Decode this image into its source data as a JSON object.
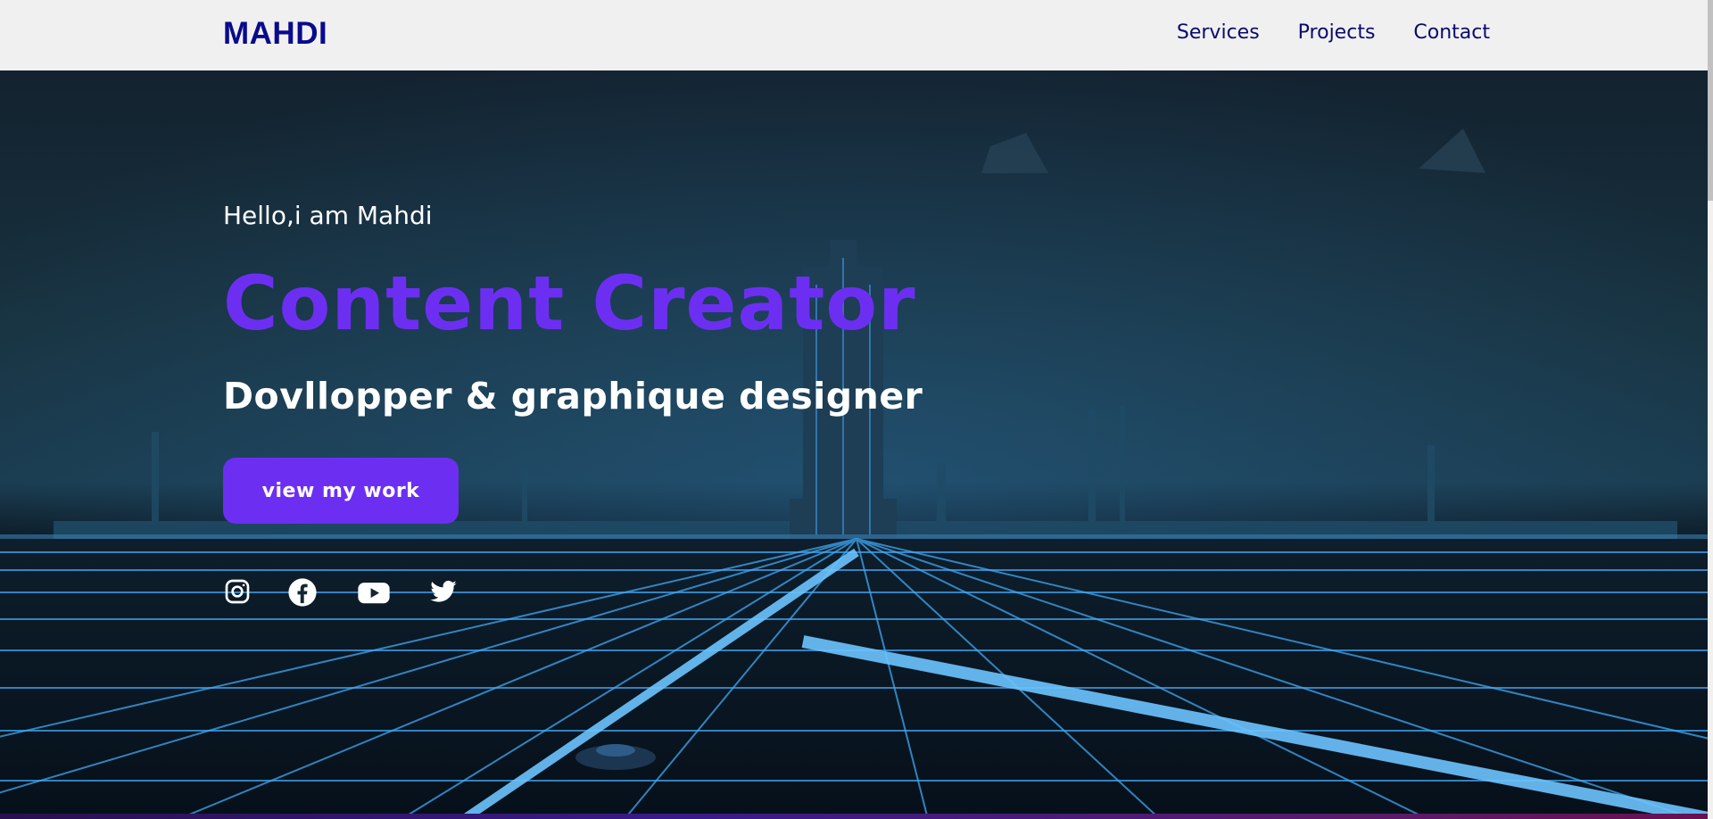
{
  "navbar": {
    "brand": "MAHDI",
    "links": [
      "Services",
      "Projects",
      "Contact"
    ]
  },
  "hero": {
    "greeting": "Hello,i am Mahdi",
    "headline": "Content Creator",
    "subheadline": "Dovllopper & graphique designer",
    "cta_label": "view my work"
  },
  "socials": [
    "instagram-icon",
    "facebook-icon",
    "youtube-icon",
    "twitter-icon"
  ],
  "colors": {
    "brand": "#0a0a8c",
    "accent": "#6c2ff2",
    "navbar_bg": "#f0f0f0",
    "hero_text": "#ffffff",
    "grid_glow": "#3fa9f5"
  }
}
